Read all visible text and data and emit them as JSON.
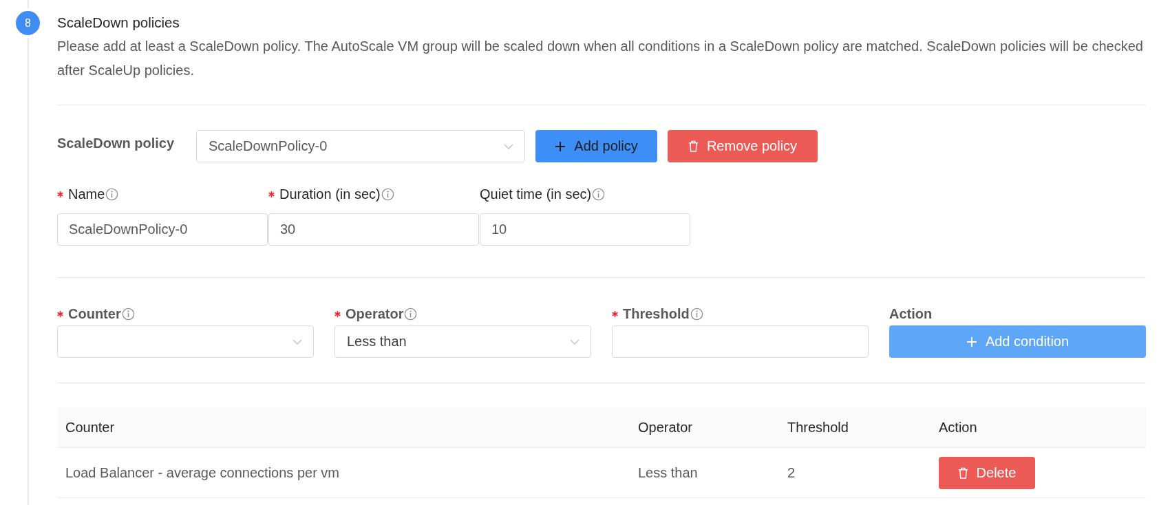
{
  "step": {
    "number": "8",
    "title": "ScaleDown policies",
    "description": "Please add at least a ScaleDown policy. The AutoScale VM group will be scaled down when all conditions in a ScaleDown policy are matched. ScaleDown policies will be checked after ScaleUp policies."
  },
  "policy_selector": {
    "label": "ScaleDown policy",
    "value": "ScaleDownPolicy-0"
  },
  "policy_buttons": [
    {
      "label": "Add policy",
      "kind": "add"
    },
    {
      "label": "Remove policy",
      "kind": "remove"
    }
  ],
  "policy_fields": [
    {
      "label": "Name",
      "required": true,
      "info": true,
      "value": "ScaleDownPolicy-0"
    },
    {
      "label": "Duration (in sec)",
      "required": true,
      "info": true,
      "value": "30"
    },
    {
      "label": "Quiet time (in sec)",
      "required": false,
      "info": true,
      "value": "10"
    }
  ],
  "condition_fields": [
    {
      "label": "Counter",
      "required": true,
      "info": true,
      "kind": "select"
    },
    {
      "label": "Operator",
      "required": true,
      "info": true,
      "kind": "select",
      "value": "Less than"
    },
    {
      "label": "Threshold",
      "required": true,
      "info": true,
      "kind": "input"
    },
    {
      "label": "Action",
      "required": false,
      "info": false,
      "kind": "button",
      "button_label": "Add condition"
    }
  ],
  "table": {
    "columns": [
      "Counter",
      "Operator",
      "Threshold",
      "Action"
    ],
    "rows": [
      {
        "cells": [
          "Load Balancer - average connections per vm",
          "Less than",
          "2"
        ],
        "action": "Delete"
      }
    ]
  }
}
